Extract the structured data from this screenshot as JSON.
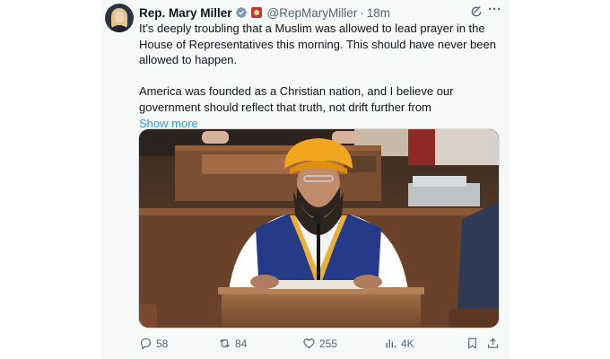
{
  "tweet": {
    "author_name": "Rep. Mary Miller",
    "handle": "@RepMaryMiller",
    "separator": "·",
    "time": "18m",
    "more_label": "···",
    "text_p1": "It’s deeply troubling that a Muslim was allowed to lead prayer in the House of Representatives this morning. This should have never been allowed to happen.",
    "text_p2": "America was founded as a Christian nation, and I believe our government should reflect that truth, not drift further from",
    "show_more": "Show more"
  },
  "actions": {
    "replies": "58",
    "reposts": "84",
    "likes": "255",
    "views": "4K"
  },
  "icons": [
    "verified-icon",
    "affiliation-badge-icon",
    "grok-icon",
    "more-icon",
    "reply-icon",
    "repost-icon",
    "like-icon",
    "views-icon",
    "bookmark-icon",
    "share-icon"
  ],
  "colors": {
    "link": "#1d9bf0",
    "secondary_text": "#536471",
    "verified": "#829aab",
    "card_bg": "#f7f9f9"
  }
}
